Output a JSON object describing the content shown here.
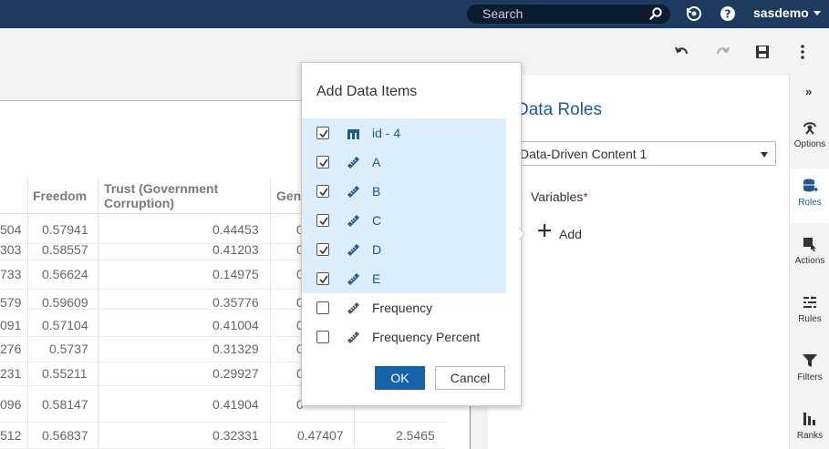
{
  "topbar": {
    "search_placeholder": "Search",
    "user_name": "sasdemo"
  },
  "table": {
    "columns": [
      "Freedom",
      "Trust (Government Corruption)",
      "Gen"
    ],
    "rows": [
      {
        "c0": "504",
        "c1": "0.57941",
        "c2": "0.44453",
        "c3": "0"
      },
      {
        "c0": "303",
        "c1": "0.58557",
        "c2": "0.41203",
        "c3": "0"
      },
      {
        "c0": "733",
        "c1": "0.56624",
        "c2": "0.14975",
        "c3": "0"
      },
      {
        "c0": "579",
        "c1": "0.59609",
        "c2": "0.35776",
        "c3": "0"
      },
      {
        "c0": "091",
        "c1": "0.57104",
        "c2": "0.41004",
        "c3": "0"
      },
      {
        "c0": "276",
        "c1": "0.5737",
        "c2": "0.31329",
        "c3": "0"
      },
      {
        "c0": "231",
        "c1": "0.55211",
        "c2": "0.29927",
        "c3": "0"
      },
      {
        "c0": "096",
        "c1": "0.58147",
        "c2": "0.41904",
        "c3": "0"
      },
      {
        "c0": "512",
        "c1": "0.56837",
        "c2": "0.32331",
        "c3": "0.47407",
        "c4": "2.5465"
      }
    ]
  },
  "roles_pane": {
    "title": "Data Roles",
    "selected_object": "Data-Driven Content 1",
    "variables_label": "Variables",
    "required_mark": "*",
    "add_label": "Add"
  },
  "rail": {
    "collapse_glyph": "»",
    "items": [
      {
        "label": "Options",
        "icon": "options-icon"
      },
      {
        "label": "Roles",
        "icon": "roles-icon"
      },
      {
        "label": "Actions",
        "icon": "actions-icon"
      },
      {
        "label": "Rules",
        "icon": "rules-icon"
      },
      {
        "label": "Filters",
        "icon": "filter-icon"
      },
      {
        "label": "Ranks",
        "icon": "ranks-icon"
      }
    ]
  },
  "dialog": {
    "title": "Add Data Items",
    "items": [
      {
        "label": "id - 4",
        "checked": true,
        "icon": "category-icon"
      },
      {
        "label": "A",
        "checked": true,
        "icon": "measure-icon"
      },
      {
        "label": "B",
        "checked": true,
        "icon": "measure-icon"
      },
      {
        "label": "C",
        "checked": true,
        "icon": "measure-icon"
      },
      {
        "label": "D",
        "checked": true,
        "icon": "measure-icon"
      },
      {
        "label": "E",
        "checked": true,
        "icon": "measure-icon"
      },
      {
        "label": "Frequency",
        "checked": false,
        "icon": "measure-icon"
      },
      {
        "label": "Frequency Percent",
        "checked": false,
        "icon": "measure-icon"
      }
    ],
    "ok_label": "OK",
    "cancel_label": "Cancel"
  },
  "colors": {
    "topbar": "#1f3a5f",
    "accent": "#1e5a8e",
    "selection": "#dceefb",
    "primary_button": "#1763aa"
  }
}
